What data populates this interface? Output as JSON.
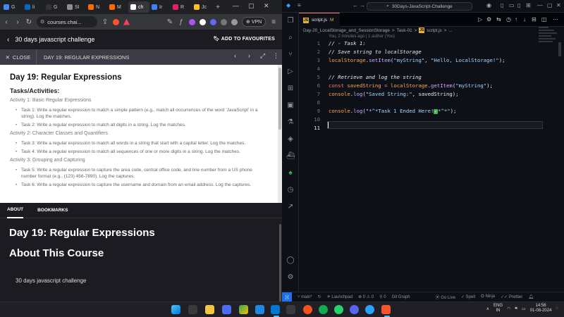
{
  "browser": {
    "tabs": [
      {
        "label": "G",
        "color": "#4285f4"
      },
      {
        "label": "li",
        "color": "#0a66c2"
      },
      {
        "label": "G",
        "color": "#333333"
      },
      {
        "label": "SI",
        "color": "#8f8f8f"
      },
      {
        "label": "N",
        "color": "#ff6a00"
      },
      {
        "label": "M",
        "color": "#ff6a00"
      },
      {
        "label": "ch",
        "color": "#ffffff"
      },
      {
        "label": "Ir",
        "color": "#3b82f6"
      },
      {
        "label": "R",
        "color": "#e91e63"
      },
      {
        "label": "Jc",
        "color": "#fbbf24"
      }
    ],
    "url": "courses.chai...",
    "vpn_label": "VPN",
    "course_title": "30 days javascript challenge",
    "add_fav": "ADD TO FAVOURITES",
    "close_label": "CLOSE",
    "lesson_title": "DAY 19: REGULAR EXPRESSIONS",
    "content": {
      "title": "Day 19: Regular Expressions",
      "subtitle": "Tasks/Activities:",
      "activities": [
        {
          "heading": "Activity 1: Basic Regular Expressions",
          "tasks": [
            "Task 1: Write a regular expression to match a simple pattern (e.g., match all occurrences of the word 'JavaScript' in a string). Log the matches.",
            "Task 2: Write a regular expression to match all digits in a string. Log the matches."
          ]
        },
        {
          "heading": "Activity 2: Character Classes and Quantifiers",
          "tasks": [
            "Task 3: Write a regular expression to match all words in a string that start with a capital letter. Log the matches.",
            "Task 4: Write a regular expression to match all sequences of one or more digits in a string. Log the matches."
          ]
        },
        {
          "heading": "Activity 3: Grouping and Capturing",
          "tasks": [
            "Task 5: Write a regular expression to capture the area code, central office code, and line number from a US phone number format (e.g., (123) 456-7890). Log the captures.",
            "Task 6: Write a regular expression to capture the username and domain from an email address. Log the captures."
          ]
        }
      ]
    },
    "lower": {
      "tab_about": "ABOUT",
      "tab_bookmarks": "BOOKMARKS",
      "heading": "Day 19: Regular Expressions",
      "about_heading": "About This Course",
      "course_name": "30 days javascript challenge"
    }
  },
  "vscode": {
    "search": "30Days-JavaScript-Challenge",
    "file_tab": "script.js",
    "file_tab_status": "M",
    "breadcrumb": [
      "Day-20_LocalStorage_and_SessionStorage",
      ">",
      "Task-01",
      ">",
      "JS",
      "script.js",
      ">",
      "..."
    ],
    "blame": "You, 2 minutes ago | 1 author (You)",
    "line_numbers": [
      "1",
      "2",
      "3",
      "4",
      "5",
      "6",
      "7",
      "8",
      "9",
      "10",
      "11"
    ],
    "status": {
      "branch": "main*",
      "launchpad": "Launchpad",
      "errors": "⊗ 0 ⚠ 0",
      "ports": "0",
      "gitgraph": "Git Graph",
      "golive": "Go Live",
      "spell": "Spell",
      "ninja": "Ninja",
      "prettier": "Prettier"
    }
  },
  "taskbar": {
    "lang": "ENG",
    "region": "IN",
    "time": "14:56",
    "date": "01-08-2024"
  }
}
